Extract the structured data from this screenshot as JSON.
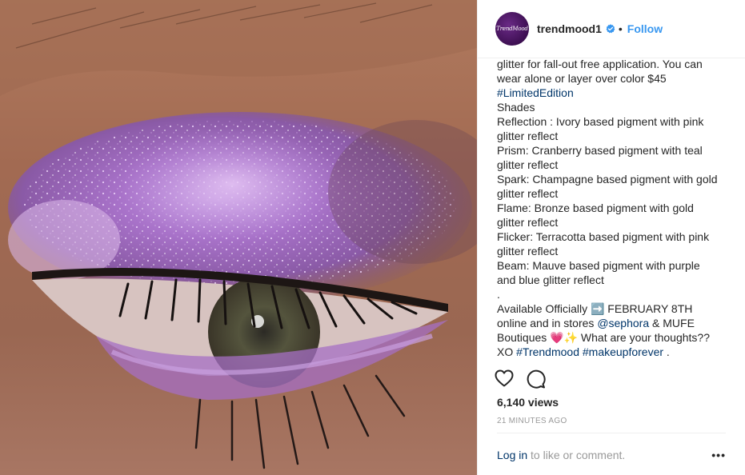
{
  "post": {
    "username": "trendmood1",
    "separator": "•",
    "follow_label": "Follow",
    "avatar_text": "TrendMood",
    "caption_lines": [
      {
        "parts": [
          {
            "text": "glitter for fall-out free application. You can",
            "type": "text"
          }
        ]
      },
      {
        "parts": [
          {
            "text": "wear alone or layer over color $45",
            "type": "text"
          }
        ]
      },
      {
        "parts": [
          {
            "text": "#LimitedEdition",
            "type": "tag"
          }
        ]
      },
      {
        "parts": [
          {
            "text": "Shades",
            "type": "text"
          }
        ]
      },
      {
        "parts": [
          {
            "text": "Reflection : Ivory based pigment with pink",
            "type": "text"
          }
        ]
      },
      {
        "parts": [
          {
            "text": "glitter reflect",
            "type": "text"
          }
        ]
      },
      {
        "parts": [
          {
            "text": "Prism: Cranberry based pigment with teal",
            "type": "text"
          }
        ]
      },
      {
        "parts": [
          {
            "text": "glitter reflect",
            "type": "text"
          }
        ]
      },
      {
        "parts": [
          {
            "text": "Spark: Champagne based pigment with gold",
            "type": "text"
          }
        ]
      },
      {
        "parts": [
          {
            "text": "glitter reflect",
            "type": "text"
          }
        ]
      },
      {
        "parts": [
          {
            "text": "Flame: Bronze based pigment with gold",
            "type": "text"
          }
        ]
      },
      {
        "parts": [
          {
            "text": "glitter reflect",
            "type": "text"
          }
        ]
      },
      {
        "parts": [
          {
            "text": "Flicker: Terracotta based pigment with pink",
            "type": "text"
          }
        ]
      },
      {
        "parts": [
          {
            "text": "glitter reflect",
            "type": "text"
          }
        ]
      },
      {
        "parts": [
          {
            "text": "Beam: Mauve based pigment with purple",
            "type": "text"
          }
        ]
      },
      {
        "parts": [
          {
            "text": "and blue glitter reflect",
            "type": "text"
          }
        ]
      },
      {
        "parts": [
          {
            "text": ".",
            "type": "text"
          }
        ]
      },
      {
        "parts": [
          {
            "text": "Available Officially ➡️ FEBRUARY 8TH",
            "type": "text"
          }
        ]
      },
      {
        "parts": [
          {
            "text": "online and in stores ",
            "type": "text"
          },
          {
            "text": "@sephora",
            "type": "tag"
          },
          {
            "text": " & MUFE",
            "type": "text"
          }
        ]
      },
      {
        "parts": [
          {
            "text": "Boutiques 💗✨ What are your thoughts??",
            "type": "text"
          }
        ]
      },
      {
        "parts": [
          {
            "text": "XO ",
            "type": "text"
          },
          {
            "text": "#Trendmood",
            "type": "tag"
          },
          {
            "text": " ",
            "type": "text"
          },
          {
            "text": "#makeupforever",
            "type": "tag"
          },
          {
            "text": " .",
            "type": "text"
          }
        ]
      }
    ],
    "views": "6,140 views",
    "timestamp": "21 MINUTES AGO",
    "login_link": "Log in",
    "login_rest": " to like or comment.",
    "more_label": "•••"
  },
  "icons": {
    "like": "heart-outline-icon",
    "comment": "comment-bubble-icon",
    "verified": "verified-badge-icon",
    "more": "more-options-icon"
  },
  "colors": {
    "link_blue": "#3897f0",
    "tag_blue": "#003569",
    "muted": "#999999",
    "text": "#262626",
    "border": "#efefef"
  }
}
